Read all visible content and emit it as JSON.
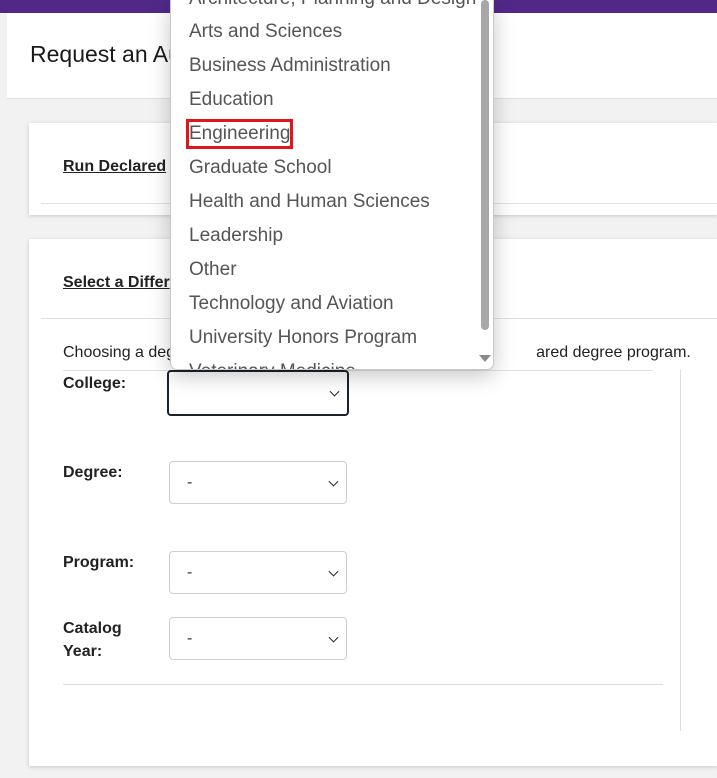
{
  "page": {
    "title": "Request an Au",
    "accent_color": "#512888"
  },
  "card1": {
    "link": "Run Declared"
  },
  "card2": {
    "link": "Select a Differ",
    "help_text_left": "Choosing a deg",
    "help_text_right": "ared degree program."
  },
  "form": {
    "college_label": "College:",
    "degree_label": "Degree:",
    "program_label": "Program:",
    "catalog_label_1": "Catalog",
    "catalog_label_2": "Year:",
    "degree_value": "-",
    "program_value": "-",
    "catalog_value": "-",
    "college_value": ""
  },
  "dropdown": {
    "options": [
      "Architecture, Planning and Design",
      "Arts and Sciences",
      "Business Administration",
      "Education",
      "Engineering",
      "Graduate School",
      "Health and Human Sciences",
      "Leadership",
      "Other",
      "Technology and Aviation",
      "University Honors Program",
      "Veterinary Medicine"
    ],
    "highlighted": "Engineering",
    "highlight_color": "#e3151a"
  }
}
